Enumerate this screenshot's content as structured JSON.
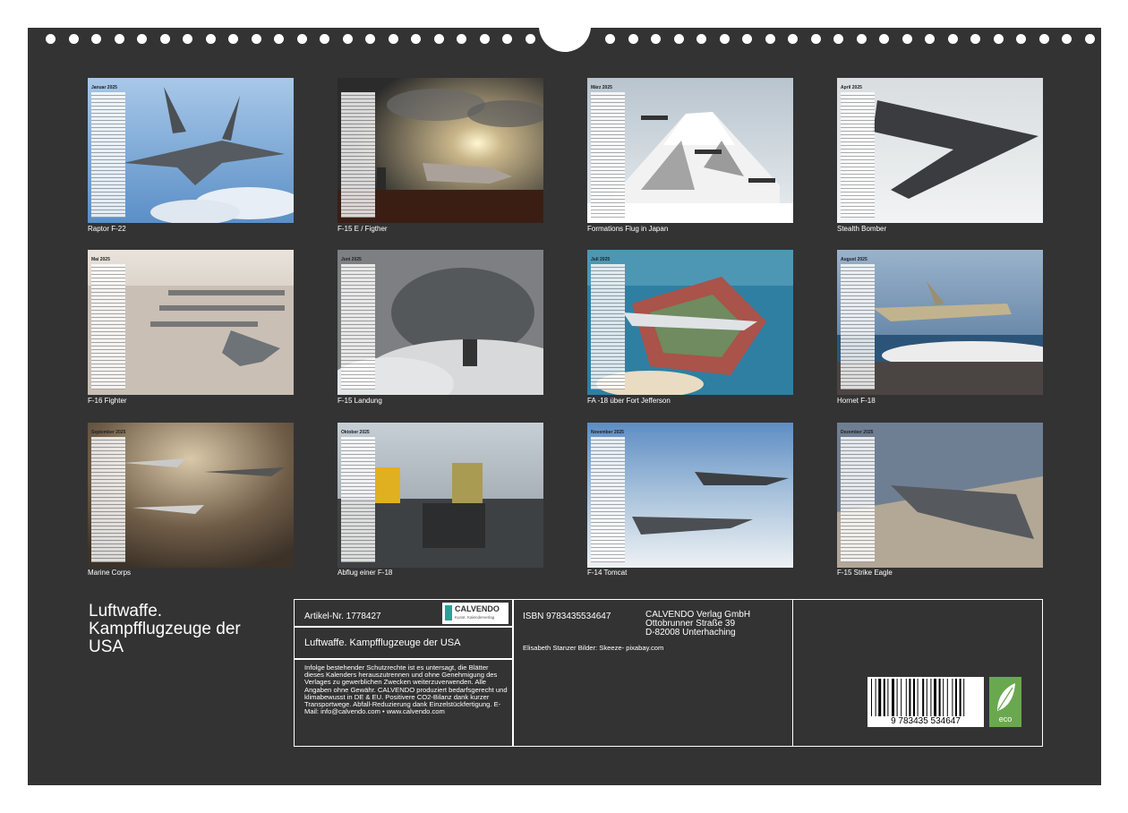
{
  "cover": {
    "background": "#333333",
    "accent_green": "#6aa84f"
  },
  "months": [
    {
      "label": "Januar 2025",
      "caption": "Raptor F-22"
    },
    {
      "label": "",
      "caption": "F-15 E / Figther"
    },
    {
      "label": "März 2025",
      "caption": "Formations Flug in Japan"
    },
    {
      "label": "April 2025",
      "caption": "Stealth Bomber"
    },
    {
      "label": "Mai 2025",
      "caption": "F-16 Fighter"
    },
    {
      "label": "Juni 2025",
      "caption": "F-15 Landung"
    },
    {
      "label": "Juli 2025",
      "caption": "FA -18 über Fort Jefferson"
    },
    {
      "label": "August 2025",
      "caption": "Hornet F-18"
    },
    {
      "label": "September 2025",
      "caption": "Marine Corps"
    },
    {
      "label": "Oktober 2025",
      "caption": "Abflug einer F-18"
    },
    {
      "label": "November 2025",
      "caption": "F-14 Tomcat"
    },
    {
      "label": "Dezember 2025",
      "caption": "F-15 Strike Eagle"
    }
  ],
  "title": "Luftwaffe. Kampfflugzeuge der USA",
  "info": {
    "article": "Artikel-Nr. 1778427",
    "logo_text": "CALVENDO",
    "logo_sub": "Kunst. Kalenderverlag",
    "product_title": "Luftwaffe. Kampfflugzeuge der USA",
    "legal_text": "Infolge bestehender Schutzrechte ist es untersagt, die Blätter dieses Kalenders herauszutrennen und ohne Genehmigung des Verlages zu gewerblichen Zwecken weiterzuverwenden. Alle Angaben ohne Gewähr. CALVENDO produziert bedarfsgerecht und klimabewusst in DE & EU. Positivere CO2-Bilanz dank kurzer Transportwege. Abfall-Reduzierung dank Einzelstückfertigung. E-Mail: info@calvendo.com • www.calvendo.com",
    "isbn": "ISBN 9783435534647",
    "publisher": [
      "CALVENDO Verlag GmbH",
      "Ottobrunner Straße 39",
      "D-82008 Unterhaching"
    ],
    "credits": "Elisabeth Stanzer Bilder: Skeeze- pixabay.com",
    "barcode_digits": "9 783435 534647",
    "eco_label": "eco"
  }
}
